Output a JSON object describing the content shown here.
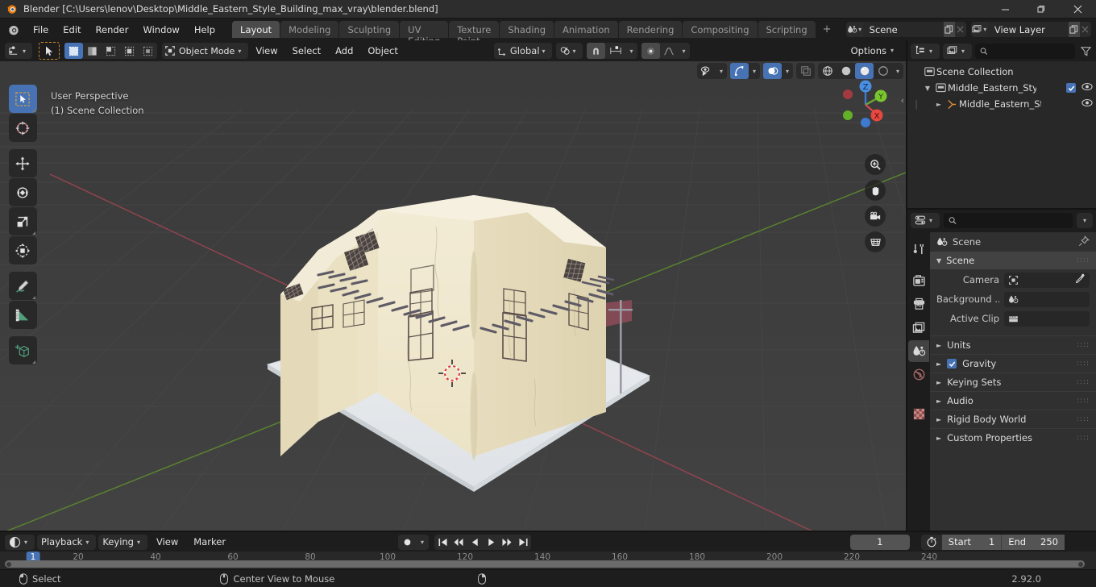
{
  "window": {
    "title": "Blender [C:\\Users\\lenov\\Desktop\\Middle_Eastern_Style_Building_max_vray\\blender.blend]",
    "minimize": "minimize-icon",
    "maximize": "maximize-icon",
    "close": "close-icon"
  },
  "menu": {
    "items": [
      "File",
      "Edit",
      "Render",
      "Window",
      "Help"
    ]
  },
  "workspaces": {
    "tabs": [
      "Layout",
      "Modeling",
      "Sculpting",
      "UV Editing",
      "Texture Paint",
      "Shading",
      "Animation",
      "Rendering",
      "Compositing",
      "Scripting"
    ],
    "active": "Layout",
    "add_label": "+"
  },
  "topbar": {
    "scene_name": "Scene",
    "view_layer_name": "View Layer"
  },
  "viewport_header": {
    "editor_type_icon": "editor-type-icon",
    "cursor_tool_icon": "cursor-tool-icon",
    "select_modes": [
      "set-select-icon",
      "extend-select-icon",
      "subtract-select-icon",
      "invert-select-icon",
      "intersect-select-icon"
    ],
    "mode": "Object Mode",
    "menus": [
      "View",
      "Select",
      "Add",
      "Object"
    ],
    "transform_orientation": "Global",
    "snap_label": "snap-magnet-icon",
    "proportional_label": "proportional-edit-icon",
    "options_label": "Options",
    "shading_modes": [
      "wireframe-shading",
      "solid-shading",
      "material-preview-shading",
      "rendered-shading"
    ],
    "active_shading": "material-preview-shading"
  },
  "viewport": {
    "perspective_label": "User Perspective",
    "collection_label": "(1) Scene Collection",
    "gizmo_axes": [
      "Z",
      "Y",
      "X"
    ],
    "nav_buttons": [
      "zoom-icon",
      "pan-hand-icon",
      "camera-view-icon",
      "toggle-perspective-icon"
    ],
    "tools": [
      "tweak-select-tool",
      "cursor-tool",
      "move-tool",
      "rotate-tool",
      "scale-tool",
      "transform-tool",
      "annotate-tool",
      "measure-tool",
      "add-cube-tool"
    ]
  },
  "outliner": {
    "display_mode_icon": "outliner-display-mode-icon",
    "filter_icon": "filter-icon",
    "search_placeholder": "",
    "rows": [
      {
        "label": "Scene Collection",
        "icon": "collection-icon",
        "depth": 0,
        "expander": "",
        "checkbox": false,
        "eye": false
      },
      {
        "label": "Middle_Eastern_Style_Bu",
        "icon": "collection-icon",
        "depth": 1,
        "expander": "▼",
        "checkbox": true,
        "eye": true
      },
      {
        "label": "Middle_Eastern_Style",
        "icon": "empty-object-icon",
        "depth": 2,
        "expander": "►",
        "checkbox": false,
        "eye": true
      }
    ]
  },
  "properties": {
    "search_placeholder": "",
    "breadcrumb": "Scene",
    "tabs": [
      "tool-tab",
      "render-tab",
      "output-tab",
      "view-layer-tab",
      "scene-tab",
      "world-tab",
      "texture-tab"
    ],
    "active_tab": "scene-tab",
    "panel_title": "Scene",
    "fields": [
      {
        "label": "Camera",
        "value": "",
        "icon": "camera-data-icon",
        "eyedropper": true
      },
      {
        "label": "Background ...",
        "value": "",
        "icon": "scene-icon",
        "eyedropper": false
      },
      {
        "label": "Active Clip",
        "value": "",
        "icon": "clip-icon",
        "eyedropper": false
      }
    ],
    "panels": [
      {
        "label": "Units",
        "checkbox": null
      },
      {
        "label": "Gravity",
        "checkbox": true
      },
      {
        "label": "Keying Sets",
        "checkbox": null
      },
      {
        "label": "Audio",
        "checkbox": null
      },
      {
        "label": "Rigid Body World",
        "checkbox": null
      },
      {
        "label": "Custom Properties",
        "checkbox": null
      }
    ]
  },
  "timeline": {
    "editor_icon": "timeline-editor-icon",
    "menus_dropdown": [
      "Playback",
      "Keying"
    ],
    "menus_plain": [
      "View",
      "Marker"
    ],
    "auto_key_icon": "record-icon",
    "transport": [
      "jump-to-start-icon",
      "jump-to-keyframe-prev-icon",
      "play-reverse-icon",
      "play-icon",
      "jump-to-keyframe-next-icon",
      "jump-to-end-icon"
    ],
    "current_frame": "1",
    "use_preview_range_icon": "stopwatch-icon",
    "start_label": "Start",
    "start_value": "1",
    "end_label": "End",
    "end_value": "250",
    "playhead_label": "1",
    "ticks": [
      "20",
      "40",
      "60",
      "80",
      "100",
      "120",
      "140",
      "160",
      "180",
      "200",
      "220",
      "240"
    ]
  },
  "statusbar": {
    "items": [
      {
        "icon": "mouse-left-icon",
        "label": "Select"
      },
      {
        "icon": "mouse-middle-icon",
        "label": "Center View to Mouse"
      },
      {
        "icon": "mouse-right-icon",
        "label": ""
      }
    ],
    "version": "2.92.0"
  },
  "colors": {
    "accent_blue": "#4772b3",
    "header_bg": "#1d1d1d",
    "panel_bg": "#303030",
    "viewport_bg": "#3d3d3d",
    "axis_x_red": "#c8485a",
    "axis_y_green": "#6aa832",
    "building_wall": "#efe7ce"
  }
}
